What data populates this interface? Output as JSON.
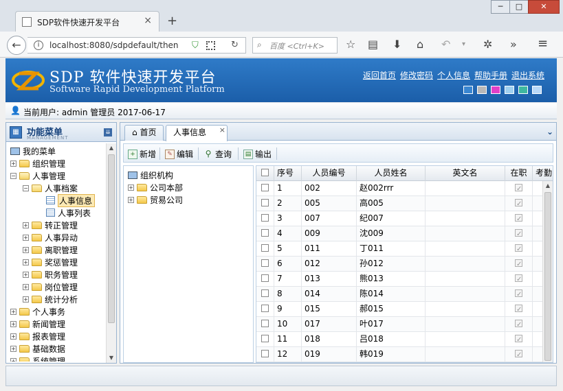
{
  "browser": {
    "tab_title": "SDP软件快速开发平台",
    "url": "localhost:8080/sdpdefault/then",
    "search_placeholder": "百度 <Ctrl+K>"
  },
  "header": {
    "title": "SDP 软件快速开发平台",
    "subtitle": "Software Rapid Development Platform",
    "links": [
      "返回首页",
      "修改密码",
      "个人信息",
      "帮助手册",
      "退出系统"
    ],
    "skin_colors": [
      "#3a86d0",
      "#b8b8b8",
      "#e040c8",
      "#9fd0f0",
      "#3fb8a0",
      "#b8d8f8"
    ]
  },
  "userbar": {
    "text": "当前用户: admin 管理员 2017-06-17"
  },
  "menu": {
    "title": "功能菜单",
    "subtitle": "MANAGEMENT",
    "items": [
      {
        "label": "我的菜单"
      },
      {
        "label": "组织管理"
      },
      {
        "label": "人事管理"
      },
      {
        "label": "人事档案"
      },
      {
        "label": "人事信息"
      },
      {
        "label": "人事列表"
      },
      {
        "label": "转正管理"
      },
      {
        "label": "人事异动"
      },
      {
        "label": "离职管理"
      },
      {
        "label": "奖惩管理"
      },
      {
        "label": "职务管理"
      },
      {
        "label": "岗位管理"
      },
      {
        "label": "统计分析"
      },
      {
        "label": "个人事务"
      },
      {
        "label": "新闻管理"
      },
      {
        "label": "报表管理"
      },
      {
        "label": "基础数据"
      },
      {
        "label": "系统管理"
      }
    ]
  },
  "content_tabs": [
    "首页",
    "人事信息"
  ],
  "toolbar": {
    "add": "新增",
    "edit": "编辑",
    "query": "查询",
    "export": "输出"
  },
  "org_tree": {
    "root": "组织机构",
    "children": [
      "公司本部",
      "贸易公司"
    ]
  },
  "grid": {
    "columns": [
      "序号",
      "人员编号",
      "人员姓名",
      "英文名",
      "在职",
      "考勤"
    ],
    "rows": [
      {
        "no": "1",
        "code": "002",
        "name": "赵002rrr"
      },
      {
        "no": "2",
        "code": "005",
        "name": "高005"
      },
      {
        "no": "3",
        "code": "007",
        "name": "纪007"
      },
      {
        "no": "4",
        "code": "009",
        "name": "沈009"
      },
      {
        "no": "5",
        "code": "011",
        "name": "丁011"
      },
      {
        "no": "6",
        "code": "012",
        "name": "孙012"
      },
      {
        "no": "7",
        "code": "013",
        "name": "熊013"
      },
      {
        "no": "8",
        "code": "014",
        "name": "陈014"
      },
      {
        "no": "9",
        "code": "015",
        "name": "郝015"
      },
      {
        "no": "10",
        "code": "017",
        "name": "叶017"
      },
      {
        "no": "11",
        "code": "018",
        "name": "吕018"
      },
      {
        "no": "12",
        "code": "019",
        "name": "韩019"
      }
    ]
  }
}
